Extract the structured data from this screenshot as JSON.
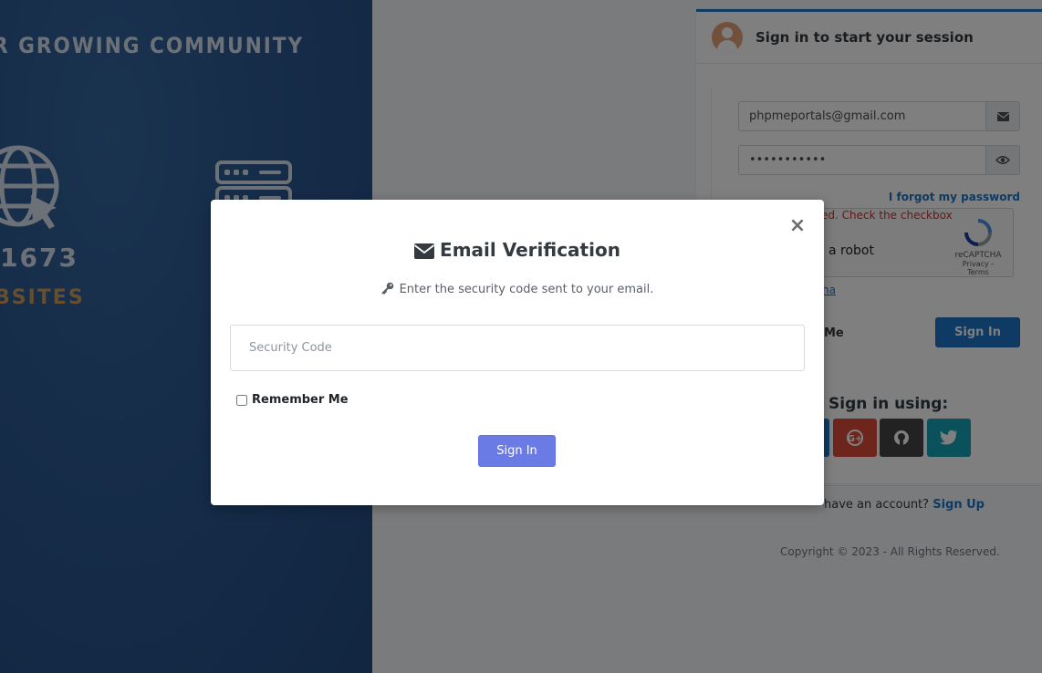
{
  "hero": {
    "heading": "R GROWING COMMUNITY",
    "count": "1673",
    "sub": "BSITES",
    "icons": [
      "globe-cursor-icon",
      "server-icon"
    ]
  },
  "login_card": {
    "title": "Sign in to start your session",
    "email_value": "phpmeportals@gmail.com",
    "password_value": "•••••••••••",
    "forgot_link": "I forgot my password",
    "captcha_error": "ed. Check the checkbox",
    "captcha_text": "a robot",
    "captcha_brand": "reCAPTCHA",
    "captcha_terms": "Privacy - Terms",
    "captcha_link": "ha",
    "remember_label": "Me",
    "signin_button": "Sign In",
    "social_title": "Sign in using:",
    "have_account_text": "have an account?",
    "signup_link": "Sign Up"
  },
  "copyright": "Copyright © 2023 - All Rights Reserved.",
  "modal": {
    "title": "Email Verification",
    "subtitle": "Enter the security code sent to your email.",
    "input_placeholder": "Security Code",
    "remember_label": "Remember Me",
    "signin_button": "Sign In",
    "close_symbol": "×"
  },
  "colors": {
    "hero_bg": "#2c5a94",
    "accent": "#1e74c6",
    "modal_button": "#6b7be6",
    "google": "#dd4b39",
    "github": "#444444",
    "twitter": "#17a2b8"
  }
}
